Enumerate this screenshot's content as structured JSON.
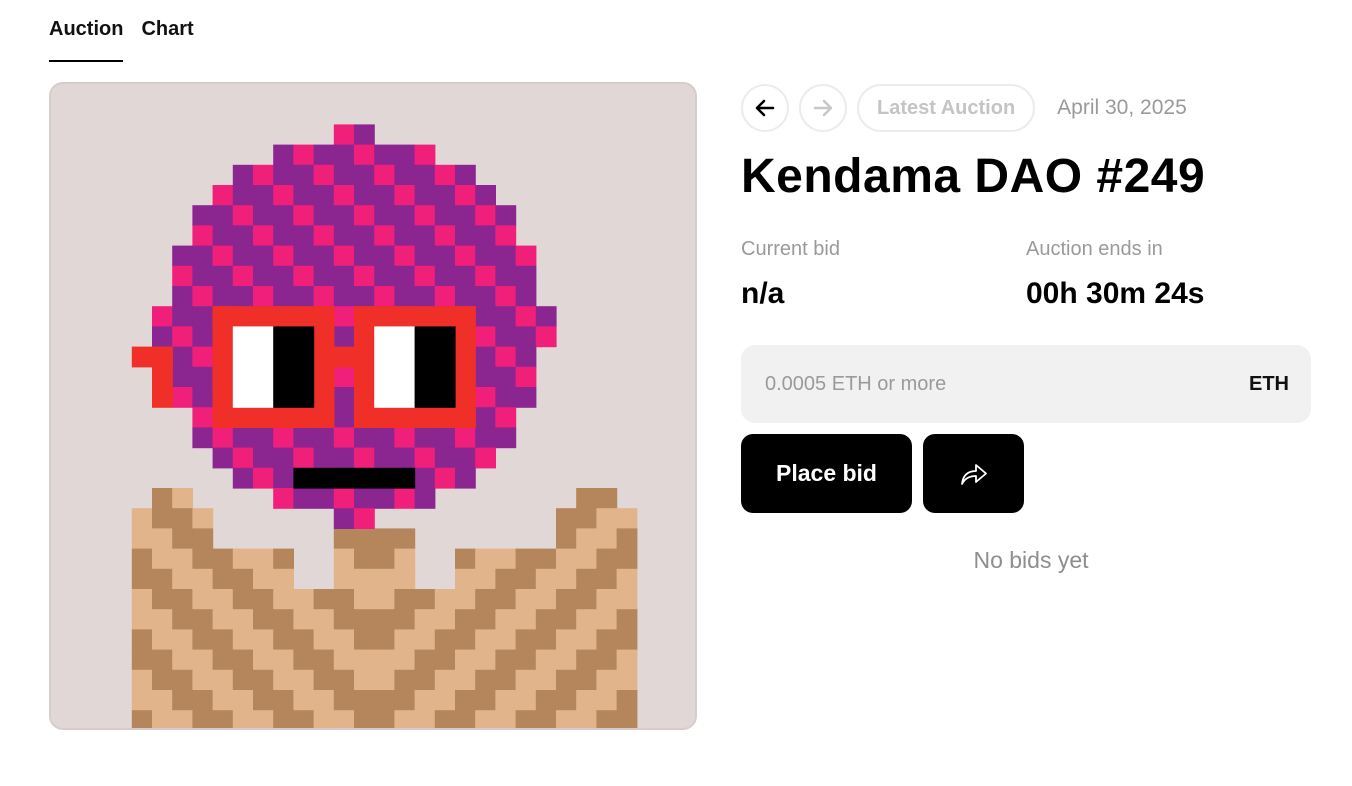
{
  "tabs": [
    {
      "label": "Auction",
      "active": true
    },
    {
      "label": "Chart",
      "active": false
    }
  ],
  "nav": {
    "prev_icon": "arrow-left-icon",
    "next_icon": "arrow-right-icon",
    "latest_label": "Latest Auction",
    "date": "April 30, 2025"
  },
  "token": {
    "title": "Kendama DAO #249"
  },
  "stats": {
    "current_bid_label": "Current bid",
    "current_bid_value": "n/a",
    "ends_label": "Auction ends in",
    "ends_value": "00h 30m 24s"
  },
  "bid": {
    "placeholder": "0.0005 ETH or more",
    "currency": "ETH",
    "place_label": "Place bid",
    "share_icon": "share-icon"
  },
  "history": {
    "empty_text": "No bids yet"
  },
  "colors": {
    "art_background": "#e1d7d6",
    "head_purple": "#8b2590",
    "head_pink": "#f0207a",
    "glasses_red": "#f03028",
    "body_light": "#e1b48b",
    "body_dark": "#b5855b",
    "button_black": "#000000"
  }
}
